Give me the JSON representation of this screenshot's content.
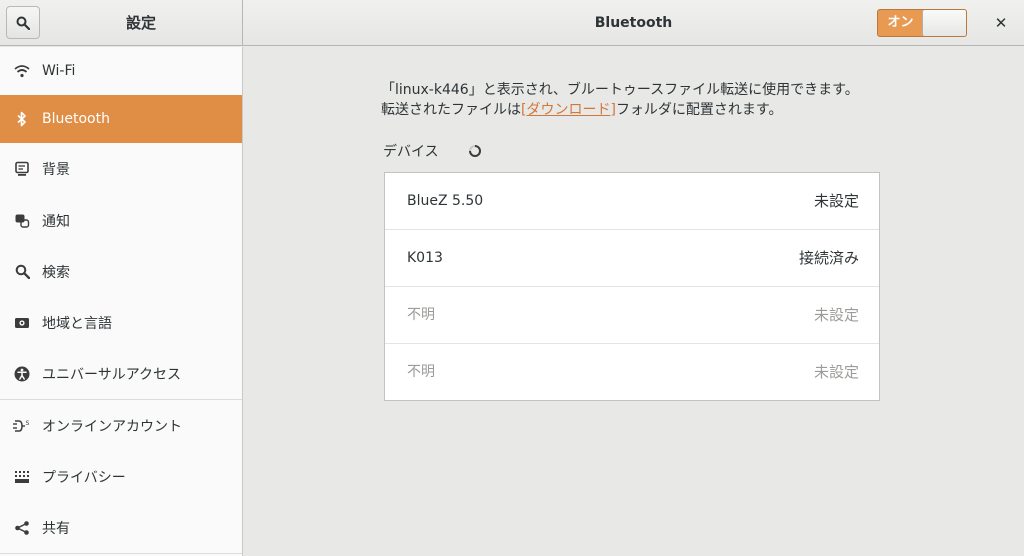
{
  "header": {
    "sidebar_title": "設定",
    "panel_title": "Bluetooth",
    "switch_label": "オン",
    "close_glyph": "✕"
  },
  "sidebar": {
    "items": [
      {
        "label": "Wi-Fi",
        "icon": "wifi-icon"
      },
      {
        "label": "Bluetooth",
        "icon": "bluetooth-icon",
        "active": true
      },
      {
        "label": "背景",
        "icon": "background-icon"
      },
      {
        "label": "通知",
        "icon": "notifications-icon"
      },
      {
        "label": "検索",
        "icon": "search-icon"
      },
      {
        "label": "地域と言語",
        "icon": "region-icon"
      },
      {
        "label": "ユニバーサルアクセス",
        "icon": "accessibility-icon"
      },
      {
        "label": "オンラインアカウント",
        "icon": "online-accounts-icon"
      },
      {
        "label": "プライバシー",
        "icon": "privacy-icon"
      },
      {
        "label": "共有",
        "icon": "share-icon"
      }
    ]
  },
  "main": {
    "info_line1": "「linux-k446」と表示され、ブルートゥースファイル転送に使用できます。",
    "info_line2_prefix": "転送されたファイルは",
    "info_link": "[ダウンロード]",
    "info_line2_suffix": "フォルダに配置されます。",
    "devices_label": "デバイス",
    "devices": [
      {
        "name": "BlueZ 5.50",
        "status": "未設定",
        "dim": false
      },
      {
        "name": "K013",
        "status": "接続済み",
        "dim": false
      },
      {
        "name": "不明",
        "status": "未設定",
        "dim": true
      },
      {
        "name": "不明",
        "status": "未設定",
        "dim": true
      }
    ]
  },
  "colors": {
    "accent": "#e08e46",
    "link": "#d2773a"
  }
}
